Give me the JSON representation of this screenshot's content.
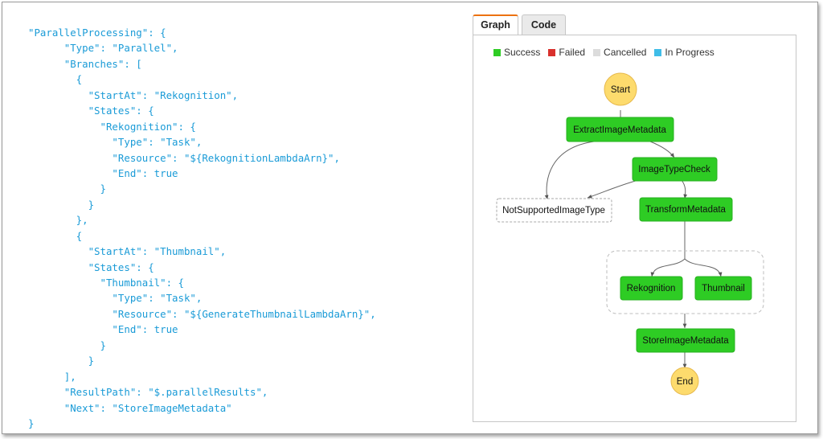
{
  "code_lines": [
    "\"ParallelProcessing\": {",
    "      \"Type\": \"Parallel\",",
    "      \"Branches\": [",
    "        {",
    "          \"StartAt\": \"Rekognition\",",
    "          \"States\": {",
    "            \"Rekognition\": {",
    "              \"Type\": \"Task\",",
    "              \"Resource\": \"${RekognitionLambdaArn}\",",
    "              \"End\": true",
    "            }",
    "          }",
    "        },",
    "        {",
    "          \"StartAt\": \"Thumbnail\",",
    "          \"States\": {",
    "            \"Thumbnail\": {",
    "              \"Type\": \"Task\",",
    "              \"Resource\": \"${GenerateThumbnailLambdaArn}\",",
    "              \"End\": true",
    "            }",
    "          }",
    "      ],",
    "      \"ResultPath\": \"$.parallelResults\",",
    "      \"Next\": \"StoreImageMetadata\"",
    "}"
  ],
  "tabs": {
    "graph": "Graph",
    "code": "Code"
  },
  "legend": {
    "success": {
      "label": "Success",
      "color": "#2ecc24"
    },
    "failed": {
      "label": "Failed",
      "color": "#d9302c"
    },
    "cancelled": {
      "label": "Cancelled",
      "color": "#dcdcdc"
    },
    "in_progress": {
      "label": "In Progress",
      "color": "#3fbde8"
    }
  },
  "nodes": {
    "start": "Start",
    "extract": "ExtractImageMetadata",
    "image_type_check": "ImageTypeCheck",
    "not_supported": "NotSupportedImageType",
    "transform": "TransformMetadata",
    "rekognition": "Rekognition",
    "thumbnail": "Thumbnail",
    "store": "StoreImageMetadata",
    "end": "End"
  },
  "colors": {
    "code_text": "#1a9bd7",
    "tab_accent": "#ec7211",
    "node_success": "#2ecc24",
    "node_terminal": "#fddb6d"
  }
}
